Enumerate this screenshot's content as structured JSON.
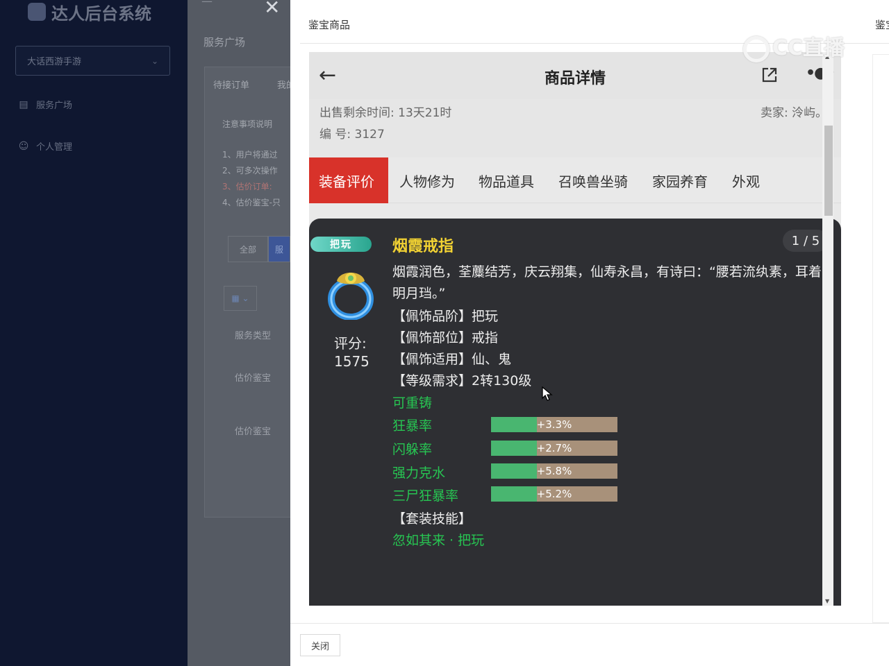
{
  "sidebar": {
    "brand": "达人后台系统",
    "game_select": "大话西游手游",
    "items": [
      {
        "label": "服务广场",
        "icon": "building-icon"
      },
      {
        "label": "个人管理",
        "icon": "user-icon"
      }
    ]
  },
  "background_page": {
    "breadcrumb": "服务广场",
    "tabs": [
      "待接订单",
      "我的"
    ],
    "notice_title": "注意事项说明",
    "notice_lines": [
      "1、用户将通过",
      "2、可多次操作",
      "3、估价订单:",
      "4、估价鉴宝-只"
    ],
    "filter_all": "全部",
    "filter_other": "服",
    "column_header": "服务类型",
    "rows": [
      "估价鉴宝",
      "估价鉴宝"
    ]
  },
  "modal": {
    "title": "鉴宝商品",
    "title_2": "鉴宝",
    "close_label": "关闭",
    "watermark": "CC直播"
  },
  "phone": {
    "header_title": "商品详情",
    "remaining_time": "出售剩余时间: 13天21时",
    "seller": "卖家: 泠屿。",
    "serial": "编 号: 3127",
    "tabs": [
      "装备评价",
      "人物修为",
      "物品道具",
      "召唤兽坐骑",
      "家园养育",
      "外观"
    ],
    "active_tab": 0
  },
  "item": {
    "badge": "把玩",
    "name": "烟霞戒指",
    "page": "1 / 5",
    "score_label": "评分:",
    "score": "1575",
    "description": "烟霞润色，荃蘪结芳，庆云翔集，仙寿永昌，有诗曰：“腰若流纨素，耳着明月珰。”",
    "props": [
      "【佩饰品阶】把玩",
      "【佩饰部位】戒指",
      "【佩饰适用】仙、鬼",
      "【等级需求】2转130级"
    ],
    "recast": "可重铸",
    "stats": [
      {
        "name": "狂暴率",
        "value": "+3.3%",
        "fill": 0.36
      },
      {
        "name": "闪躲率",
        "value": "+2.7%",
        "fill": 0.36
      },
      {
        "name": "强力克水",
        "value": "+5.8%",
        "fill": 0.36
      },
      {
        "name": "三尸狂暴率",
        "value": "+5.2%",
        "fill": 0.36
      }
    ],
    "set_skill_label": "【套装技能】",
    "set_skill": "忽如其来 · 把玩"
  },
  "colors": {
    "active_tab": "#d8322a",
    "item_name": "#f2d233",
    "stat_green": "#27c552",
    "bar_fill": "#49b670",
    "bar_track": "#a8917a",
    "card_bg": "#2e2f33"
  }
}
